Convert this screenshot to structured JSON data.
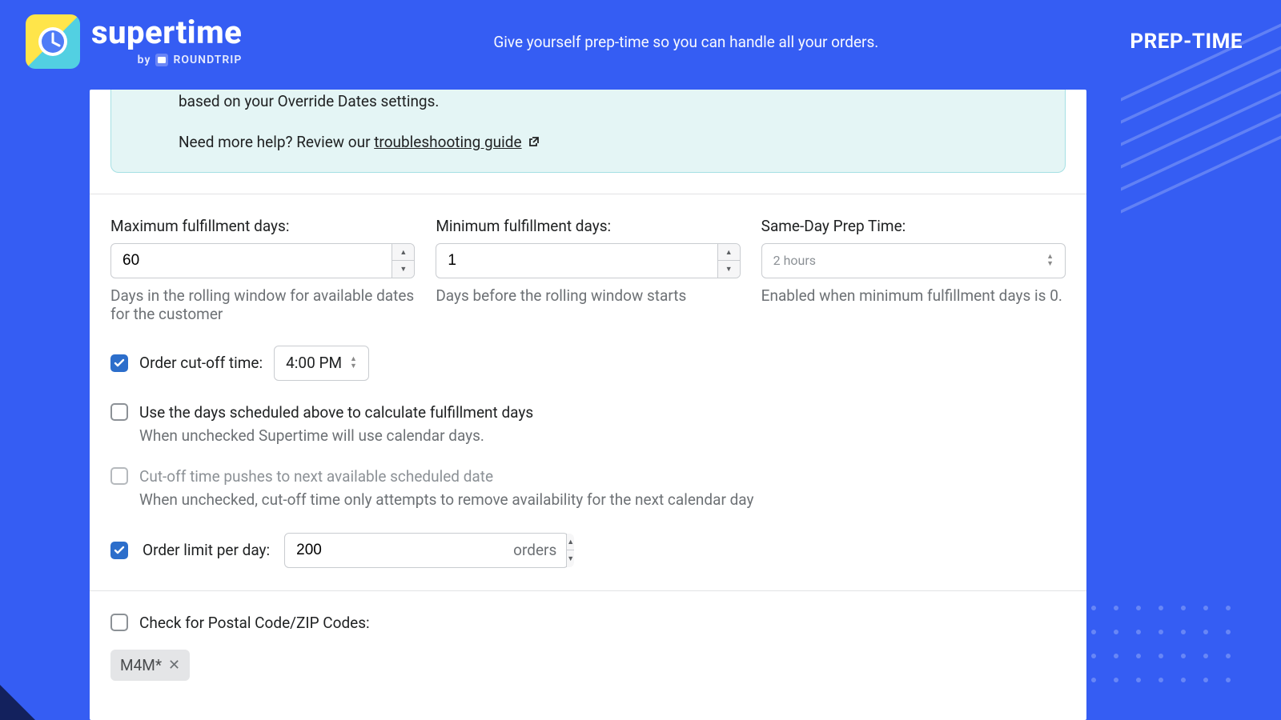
{
  "header": {
    "brand_name": "supertime",
    "byline_prefix": "by",
    "byline_brand": "ROUNDTRIP",
    "tagline": "Give yourself prep-time so you can handle all your orders.",
    "page_badge": "PREP-TIME"
  },
  "info": {
    "fragment": "based on your Override Dates settings.",
    "help_prefix": "Need more help? Review our ",
    "help_link": "troubleshooting guide"
  },
  "fields": {
    "max_days": {
      "label": "Maximum fulfillment days:",
      "value": "60",
      "help": "Days in the rolling window for available dates for the customer"
    },
    "min_days": {
      "label": "Minimum fulfillment days:",
      "value": "1",
      "help": "Days before the rolling window starts"
    },
    "same_day": {
      "label": "Same-Day Prep Time:",
      "value": "2 hours",
      "help": "Enabled when minimum fulfillment days is 0."
    }
  },
  "options": {
    "cutoff": {
      "label": "Order cut-off time:",
      "value": "4:00 PM",
      "checked": true
    },
    "use_scheduled": {
      "label": "Use the days scheduled above to calculate fulfillment days",
      "help": "When unchecked Supertime will use calendar days.",
      "checked": false
    },
    "cutoff_push": {
      "label": "Cut-off time pushes to next available scheduled date",
      "help": "When unchecked, cut-off time only attempts to remove availability for the next calendar day",
      "checked": false,
      "disabled": true
    },
    "order_limit": {
      "label": "Order limit per day:",
      "value": "200",
      "suffix": "orders",
      "checked": true
    },
    "postal": {
      "label": "Check for Postal Code/ZIP Codes:",
      "checked": false
    }
  },
  "tags": {
    "postal_tag": "M4M*"
  }
}
